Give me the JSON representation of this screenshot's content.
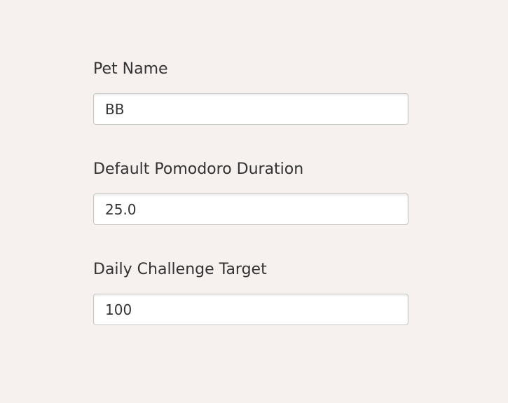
{
  "settings": {
    "pet_name": {
      "label": "Pet Name",
      "value": "BB"
    },
    "pomodoro_duration": {
      "label": "Default Pomodoro Duration",
      "value": "25.0"
    },
    "challenge_target": {
      "label": "Daily Challenge Target",
      "value": "100"
    }
  },
  "colors": {
    "background": "#f6f1ee",
    "text": "#333333",
    "input_border": "#c9c7c5",
    "input_background": "#ffffff"
  }
}
